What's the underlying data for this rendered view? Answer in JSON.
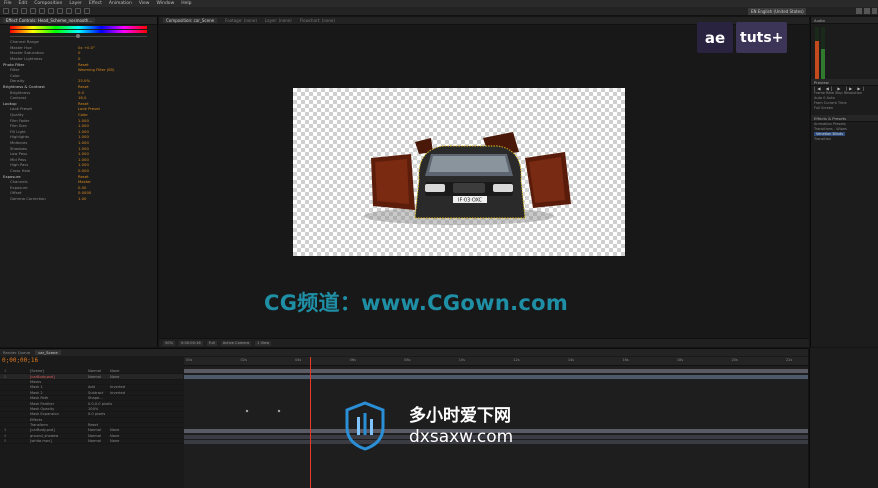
{
  "menu": [
    "File",
    "Edit",
    "Composition",
    "Layer",
    "Effect",
    "Animation",
    "View",
    "Window",
    "Help"
  ],
  "workspace": "EN English (United States)",
  "effect_panel": {
    "tab_label": "Effect Controls: Head_Scheme_nosmooth...",
    "rows": [
      {
        "label": "Channel Range",
        "value": "",
        "kind": "sub"
      },
      {
        "label": "Master Hue",
        "value": "0x +0.0°",
        "kind": "sub"
      },
      {
        "label": "Master Saturation",
        "value": "0",
        "kind": "sub"
      },
      {
        "label": "Master Lightness",
        "value": "0",
        "kind": "sub"
      },
      {
        "label": "Photo Filter",
        "value": "Reset",
        "kind": "fx"
      },
      {
        "label": "Filter",
        "value": "Warming Filter (85)",
        "kind": "sub"
      },
      {
        "label": "Color",
        "value": "",
        "kind": "sub"
      },
      {
        "label": "Density",
        "value": "25.0%",
        "kind": "sub"
      },
      {
        "label": "Brightness & Contrast",
        "value": "Reset",
        "kind": "fx"
      },
      {
        "label": "Brightness",
        "value": "0.0",
        "kind": "sub"
      },
      {
        "label": "Contrast",
        "value": "18.0",
        "kind": "sub"
      },
      {
        "label": "Lookup",
        "value": "Reset",
        "kind": "fx"
      },
      {
        "label": "Look Preset",
        "value": "Look Preset",
        "kind": "sub"
      },
      {
        "label": "Quality",
        "value": "Color",
        "kind": "sub"
      },
      {
        "label": "Film Fader",
        "value": "1.000",
        "kind": "sub"
      },
      {
        "label": "Film Size",
        "value": "1.000",
        "kind": "sub"
      },
      {
        "label": "Fill Light",
        "value": "1.000",
        "kind": "sub"
      },
      {
        "label": "Highlights",
        "value": "1.000",
        "kind": "sub"
      },
      {
        "label": "Midtones",
        "value": "1.000",
        "kind": "sub"
      },
      {
        "label": "Shadows",
        "value": "1.000",
        "kind": "sub"
      },
      {
        "label": "Low Pass",
        "value": "1.000",
        "kind": "sub"
      },
      {
        "label": "Mid Pass",
        "value": "1.000",
        "kind": "sub"
      },
      {
        "label": "High Pass",
        "value": "1.000",
        "kind": "sub"
      },
      {
        "label": "Cross Halo",
        "value": "0.000",
        "kind": "sub"
      },
      {
        "label": "Exposure",
        "value": "Reset",
        "kind": "fx"
      },
      {
        "label": "Channels",
        "value": "Master",
        "kind": "sub"
      },
      {
        "label": "Exposure",
        "value": "0.00",
        "kind": "sub"
      },
      {
        "label": "Offset",
        "value": "0.0000",
        "kind": "sub"
      },
      {
        "label": "Gamma Correction",
        "value": "1.00",
        "kind": "sub"
      }
    ]
  },
  "viewer": {
    "tabs": [
      "Composition: car_Scene",
      "Footage: (none)",
      "Layer: (none)",
      "Flowchart: (none)"
    ],
    "bottom": [
      "50%",
      "0:00:00:16",
      "Full",
      "Active Camera",
      "1 View"
    ]
  },
  "badge": {
    "ae": "ae",
    "tuts": "tuts+"
  },
  "watermark_cg": "CG频道：www.CGown.com",
  "right_panel": {
    "audio_tab": "Audio",
    "preview_tab": "Preview",
    "effects_tab": "Effects & Presets",
    "rows": [
      "Frame Rate   Skip   Resolution",
      "Auto   0   Auto",
      "From Current Time",
      "Full Screen",
      "Animation Presets",
      "Transitions - Wipes",
      "Venetian Blinds",
      "Transition"
    ]
  },
  "timeline": {
    "tabs": [
      "Render Queue",
      "car_Scene"
    ],
    "timecode": "0;00;00;16",
    "ticks": [
      "00s",
      "02s",
      "04s",
      "06s",
      "08s",
      "10s",
      "12s",
      "14s",
      "16s",
      "18s",
      "20s",
      "22s"
    ],
    "layers": [
      {
        "num": "1",
        "name": "[Scene]",
        "mode": "Normal",
        "parent": "None"
      },
      {
        "num": "2",
        "name": "[carBody.psd]",
        "mode": "Normal",
        "parent": "None"
      },
      {
        "num": "",
        "name": "Masks",
        "mode": "",
        "parent": ""
      },
      {
        "num": "",
        "name": "Mask 1",
        "mode": "Add",
        "parent": "Inverted"
      },
      {
        "num": "",
        "name": "Mask 2",
        "mode": "Subtract",
        "parent": "Inverted"
      },
      {
        "num": "",
        "name": "Mask Path",
        "mode": "Shape...",
        "parent": ""
      },
      {
        "num": "",
        "name": "Mask Feather",
        "mode": "0.0,0.0 pixels",
        "parent": ""
      },
      {
        "num": "",
        "name": "Mask Opacity",
        "mode": "100%",
        "parent": ""
      },
      {
        "num": "",
        "name": "Mask Expansion",
        "mode": "0.0 pixels",
        "parent": ""
      },
      {
        "num": "",
        "name": "Effects",
        "mode": "",
        "parent": ""
      },
      {
        "num": "",
        "name": "Transform",
        "mode": "Reset",
        "parent": ""
      },
      {
        "num": "3",
        "name": "[carBody.psd]",
        "mode": "Normal",
        "parent": "None"
      },
      {
        "num": "4",
        "name": "ground_shadow",
        "mode": "Normal",
        "parent": "None"
      },
      {
        "num": "5",
        "name": "[white.mov]",
        "mode": "Normal",
        "parent": "None"
      }
    ]
  },
  "watermark_dx": {
    "line1": "多小时爱下网",
    "line2": "dxsaxw.com"
  }
}
